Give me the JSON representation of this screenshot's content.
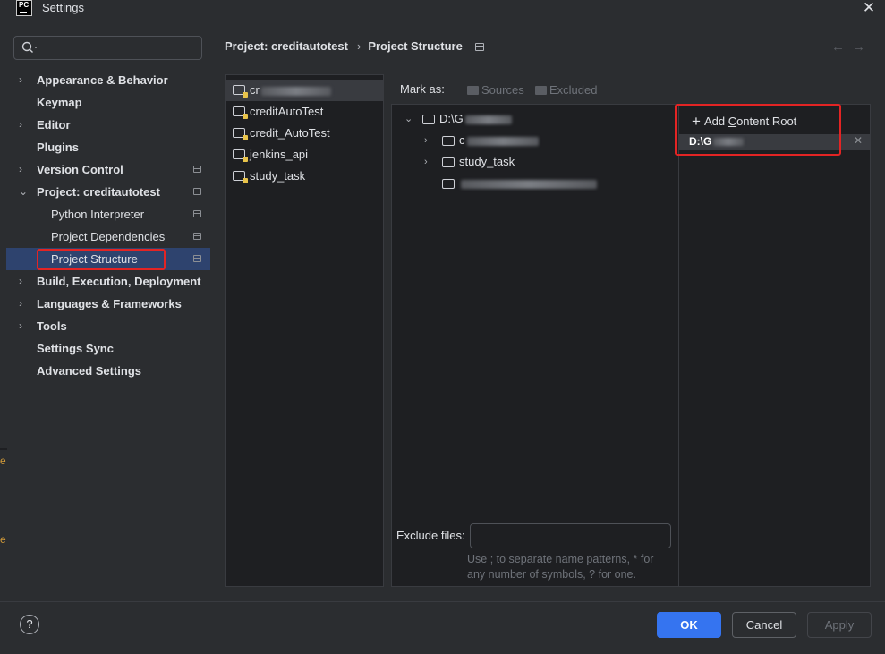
{
  "window": {
    "title": "Settings",
    "logo_text": "PC"
  },
  "sidebar": {
    "items": [
      {
        "label": "Appearance & Behavior",
        "chevron": "›",
        "level": 0,
        "pin": false
      },
      {
        "label": "Keymap",
        "chevron": "",
        "level": 0,
        "pin": false
      },
      {
        "label": "Editor",
        "chevron": "›",
        "level": 0,
        "pin": false
      },
      {
        "label": "Plugins",
        "chevron": "",
        "level": 0,
        "pin": false
      },
      {
        "label": "Version Control",
        "chevron": "›",
        "level": 0,
        "pin": true
      },
      {
        "label": "Project: creditautotest",
        "chevron": "⌄",
        "level": 0,
        "pin": true
      },
      {
        "label": "Python Interpreter",
        "chevron": "",
        "level": 1,
        "pin": true
      },
      {
        "label": "Project Dependencies",
        "chevron": "",
        "level": 1,
        "pin": true
      },
      {
        "label": "Project Structure",
        "chevron": "",
        "level": 1,
        "pin": true,
        "selected": true
      },
      {
        "label": "Build, Execution, Deployment",
        "chevron": "›",
        "level": 0,
        "pin": false
      },
      {
        "label": "Languages & Frameworks",
        "chevron": "›",
        "level": 0,
        "pin": false
      },
      {
        "label": "Tools",
        "chevron": "›",
        "level": 0,
        "pin": false
      },
      {
        "label": "Settings Sync",
        "chevron": "",
        "level": 0,
        "pin": false
      },
      {
        "label": "Advanced Settings",
        "chevron": "",
        "level": 0,
        "pin": false
      }
    ]
  },
  "breadcrumb": {
    "project": "Project: creditautotest",
    "separator": "›",
    "page": "Project Structure"
  },
  "modules": [
    {
      "label": "cr",
      "selected": true,
      "blurred": true
    },
    {
      "label": "creditAutoTest"
    },
    {
      "label": "credit_AutoTest"
    },
    {
      "label": "jenkins_api"
    },
    {
      "label": "study_task"
    }
  ],
  "mark_as": {
    "label": "Mark as:",
    "sources": "Sources",
    "excluded": "Excluded"
  },
  "tree": [
    {
      "label": "D:\\G",
      "chevron": "⌄",
      "indent": 0,
      "blurred": true
    },
    {
      "label": "c",
      "chevron": "›",
      "indent": 1,
      "blurred": true
    },
    {
      "label": "study_task",
      "chevron": "›",
      "indent": 1
    },
    {
      "label": "",
      "chevron": "",
      "indent": 1,
      "blurred": true
    }
  ],
  "content_roots": {
    "add_label": "Add Content Root",
    "add_underline_char": "C",
    "root_path": "D:\\G",
    "remove_icon": "close-icon"
  },
  "exclude": {
    "label": "Exclude files:",
    "value": "",
    "hint_line1": "Use ; to separate name patterns, * for",
    "hint_line2": "any number of symbols, ? for one."
  },
  "buttons": {
    "help": "?",
    "ok": "OK",
    "cancel": "Cancel",
    "apply": "Apply"
  },
  "colors": {
    "accent": "#3574f0",
    "highlight_box": "#e32424",
    "selection": "#2e436e"
  }
}
